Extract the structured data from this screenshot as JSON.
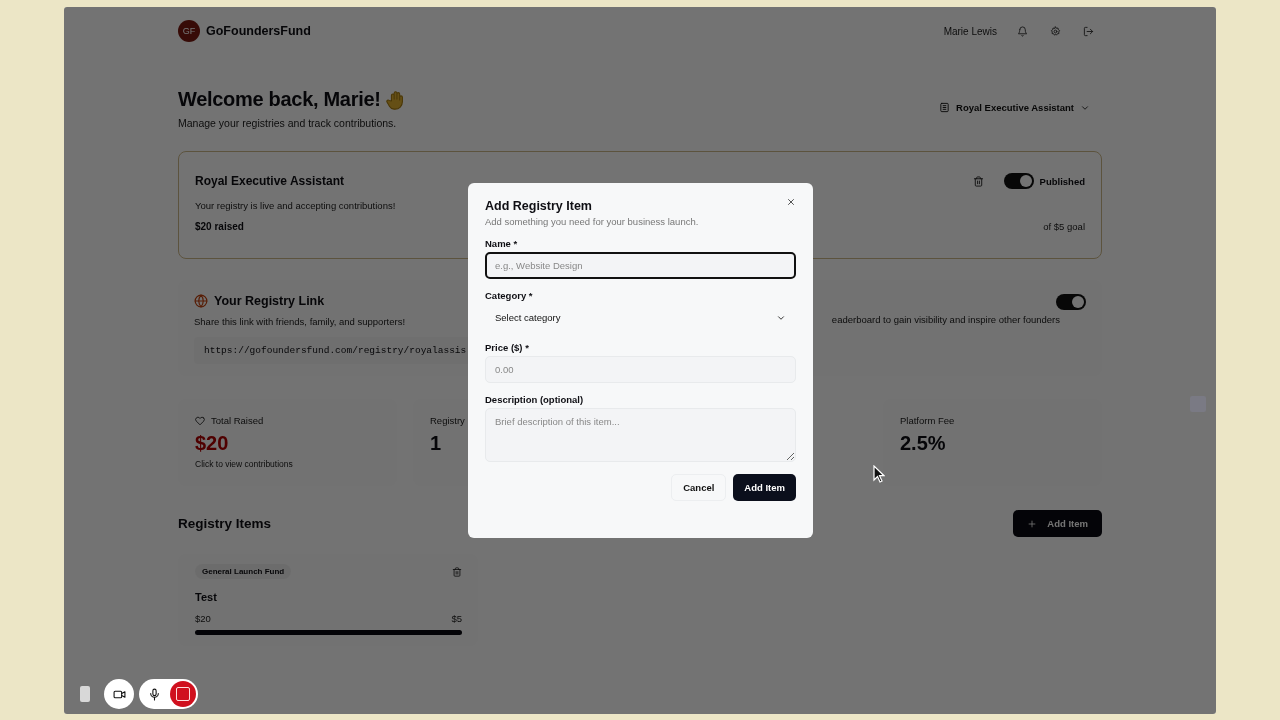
{
  "top_bar": {
    "brand_initials": "GF",
    "brand_name": "GoFoundersFund",
    "user_name": "Marie Lewis"
  },
  "header": {
    "title": "Welcome back, Marie!",
    "subtitle": "Manage your registries and track contributions.",
    "registry_selector": "Royal Executive Assistant"
  },
  "registry_card": {
    "title": "Royal Executive Assistant",
    "published": true,
    "status_label": "Published",
    "description": "Your registry is live and accepting contributions!",
    "raised": "$20 raised",
    "goal": "of $5 goal"
  },
  "link_card": {
    "title": "Your Registry Link",
    "description": "Share this link with friends, family, and supporters!",
    "url": "https://gofoundersfund.com/registry/royalassis"
  },
  "leaderboard_card": {
    "on": true,
    "description": "eaderboard to gain visibility and inspire other founders"
  },
  "stats": [
    {
      "kind": "highlight",
      "label": "Total Raised",
      "value": "$20",
      "note": "Click to view contributions"
    },
    {
      "kind": "plain",
      "label": "Registry",
      "value": "1"
    },
    {
      "kind": "plain",
      "label": "Platform Fee",
      "value": "2.5%"
    }
  ],
  "items_section": {
    "title": "Registry Items",
    "add_button": "Add Item"
  },
  "items": [
    {
      "category": "General Launch Fund",
      "name": "Test",
      "raised": "$20",
      "goal": "$5",
      "level": 1
    }
  ],
  "modal": {
    "title": "Add Registry Item",
    "subtitle": "Add something you need for your business launch.",
    "fields": [
      {
        "kind": "input",
        "label": "Name *",
        "placeholder": "e.g., Website Design",
        "focused": true
      },
      {
        "kind": "select",
        "label": "Category *",
        "value": "Select category",
        "focused": false
      },
      {
        "kind": "input",
        "label": "Price ($) *",
        "placeholder": "0.00",
        "focused": false
      },
      {
        "kind": "textarea",
        "label": "Description (optional)",
        "placeholder": "Brief description of this item...",
        "focused": false
      }
    ],
    "buttons": [
      {
        "kind": "secondary",
        "label": "Cancel"
      },
      {
        "kind": "primary",
        "label": "Add Item"
      }
    ]
  }
}
